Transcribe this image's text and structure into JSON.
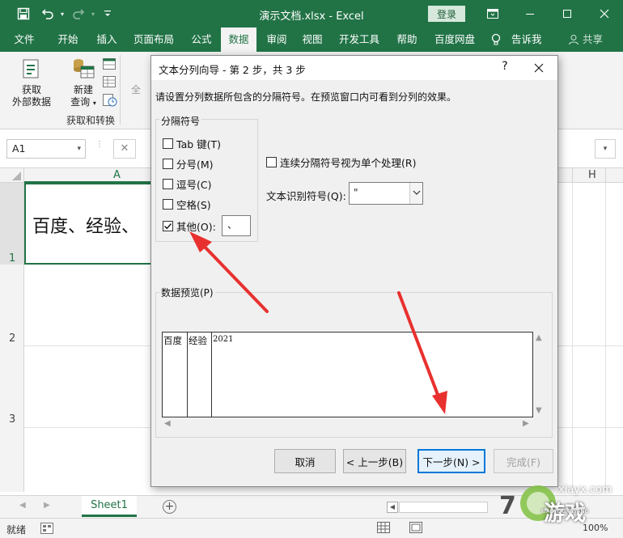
{
  "window": {
    "doc_title": "演示文档.xlsx  -  Excel",
    "login_label": "登录"
  },
  "tabs": [
    {
      "label": "文件"
    },
    {
      "label": "开始"
    },
    {
      "label": "插入"
    },
    {
      "label": "页面布局"
    },
    {
      "label": "公式"
    },
    {
      "label": "数据"
    },
    {
      "label": "审阅"
    },
    {
      "label": "视图"
    },
    {
      "label": "开发工具"
    },
    {
      "label": "帮助"
    },
    {
      "label": "百度网盘"
    }
  ],
  "tell_me": "告诉我",
  "share_label": "共享",
  "ribbon": {
    "get_external_data": "获取\n外部数据",
    "new_query_line1": "新建",
    "new_query_line2": "查询",
    "refresh_all_fragment": "全",
    "group_get_transform": "获取和转换"
  },
  "formula_bar": {
    "name_box": "A1",
    "cancel_icon": "✕"
  },
  "grid": {
    "columns": [
      "A",
      "H"
    ],
    "rows": [
      "1",
      "2",
      "3"
    ],
    "a1_visible_text": "百度、经验、"
  },
  "sheets": [
    {
      "name": "Sheet1"
    }
  ],
  "status": {
    "ready": "就绪",
    "zoom": "100%"
  },
  "dialog": {
    "title": "文本分列向导 - 第 2 步，共 3 步",
    "help": "?",
    "instruction": "请设置分列数据所包含的分隔符号。在预览窗口内可看到分列的效果。",
    "delimiters_legend": "分隔符号",
    "delimiters": [
      {
        "label": "Tab 键(T)",
        "checked": false
      },
      {
        "label": "分号(M)",
        "checked": false
      },
      {
        "label": "逗号(C)",
        "checked": false
      },
      {
        "label": "空格(S)",
        "checked": false
      },
      {
        "label": "其他(O):",
        "checked": true
      }
    ],
    "other_value": "、",
    "consecutive_label": "连续分隔符号视为单个处理(R)",
    "consecutive_checked": false,
    "qualifier_label": "文本识别符号(Q):",
    "qualifier_value": "\"",
    "preview_label": "数据预览(P)",
    "preview_columns": [
      "百度",
      "经验",
      "2021"
    ],
    "buttons": {
      "cancel": "取消",
      "back": "< 上一步(B)",
      "next": "下一步(N) >",
      "finish": "完成(F)"
    }
  },
  "watermark": {
    "site": "xiayx.com",
    "brand_text": "游戏",
    "brand_pinyin": "XIAOYOUXIWANG"
  },
  "colors": {
    "excel_green": "#217346",
    "annotation_red": "#e8312f",
    "primary_blue": "#0078d7"
  }
}
